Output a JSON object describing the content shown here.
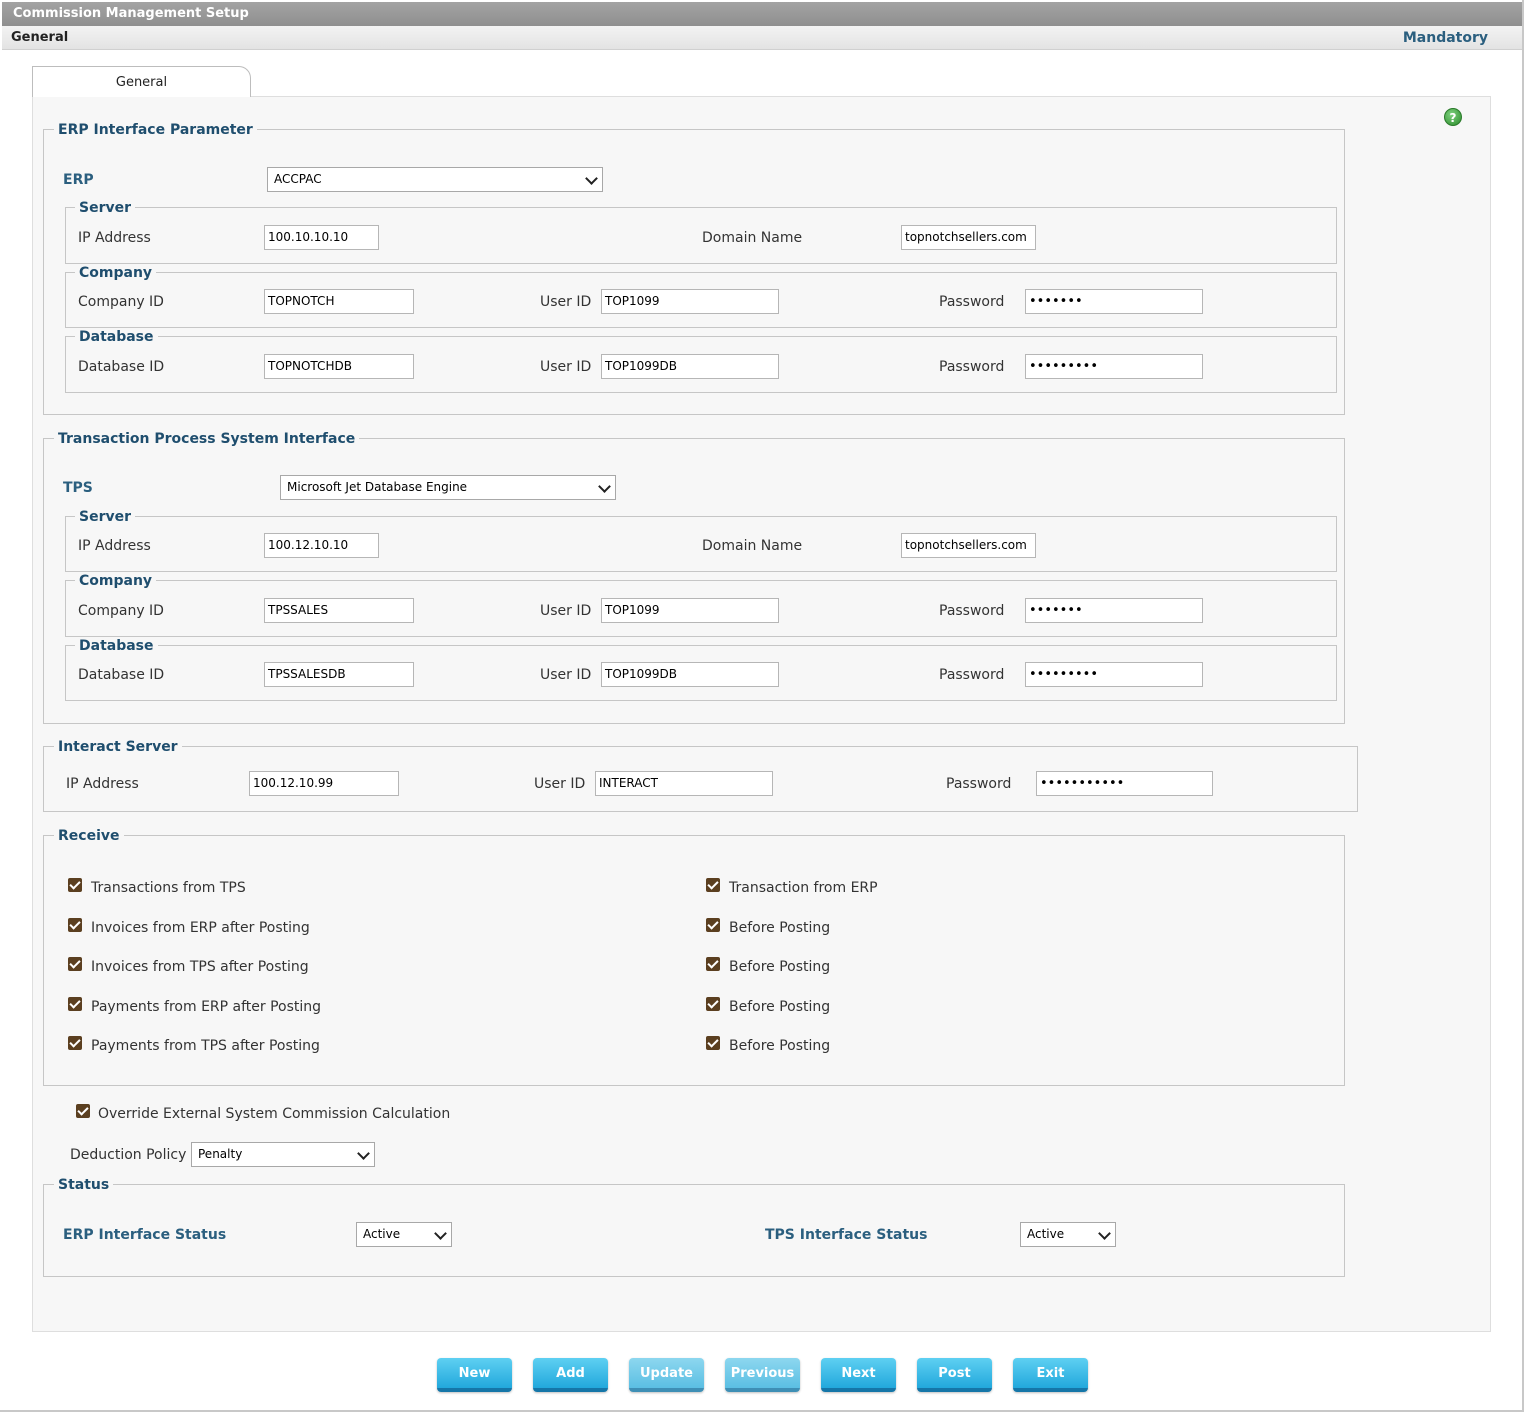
{
  "window": {
    "title": "Commission Management Setup",
    "section": "General",
    "mandatory": "Mandatory"
  },
  "tab": {
    "label": "General"
  },
  "help_icon": "?",
  "erp": {
    "legend": "ERP Interface Parameter",
    "label": "ERP",
    "value": "ACCPAC",
    "server": {
      "legend": "Server",
      "ip_label": "IP Address",
      "ip": "100.10.10.10",
      "domain_label": "Domain Name",
      "domain": "topnotchsellers.com"
    },
    "company": {
      "legend": "Company",
      "id_label": "Company ID",
      "id": "TOPNOTCH",
      "user_label": "User ID",
      "user": "TOP1099",
      "pw_label": "Password",
      "pw": "•••••••"
    },
    "database": {
      "legend": "Database",
      "id_label": "Database ID",
      "id": "TOPNOTCHDB",
      "user_label": "User ID",
      "user": "TOP1099DB",
      "pw_label": "Password",
      "pw": "•••••••••"
    }
  },
  "tps": {
    "legend": "Transaction Process System Interface",
    "label": "TPS",
    "value": "Microsoft Jet Database Engine",
    "server": {
      "legend": "Server",
      "ip_label": "IP Address",
      "ip": "100.12.10.10",
      "domain_label": "Domain Name",
      "domain": "topnotchsellers.com"
    },
    "company": {
      "legend": "Company",
      "id_label": "Company ID",
      "id": "TPSSALES",
      "user_label": "User ID",
      "user": "TOP1099",
      "pw_label": "Password",
      "pw": "•••••••"
    },
    "database": {
      "legend": "Database",
      "id_label": "Database ID",
      "id": "TPSSALESDB",
      "user_label": "User ID",
      "user": "TOP1099DB",
      "pw_label": "Password",
      "pw": "•••••••••"
    }
  },
  "interact": {
    "legend": "Interact Server",
    "ip_label": "IP Address",
    "ip": "100.12.10.99",
    "user_label": "User ID",
    "user": "INTERACT",
    "pw_label": "Password",
    "pw": "•••••••••••"
  },
  "receive": {
    "legend": "Receive",
    "left": [
      "Transactions from TPS",
      "Invoices from ERP after Posting",
      "Invoices from TPS after Posting",
      "Payments from ERP after Posting",
      "Payments from TPS after Posting"
    ],
    "right": [
      "Transaction from ERP",
      "Before Posting",
      "Before Posting",
      "Before Posting",
      "Before Posting"
    ]
  },
  "override": {
    "label": "Override External System Commission Calculation"
  },
  "deduction": {
    "label": "Deduction Policy",
    "value": "Penalty"
  },
  "status": {
    "legend": "Status",
    "erp_label": "ERP Interface Status",
    "erp_value": "Active",
    "tps_label": "TPS Interface Status",
    "tps_value": "Active"
  },
  "buttons": {
    "new": "New",
    "add": "Add",
    "update": "Update",
    "previous": "Previous",
    "next": "Next",
    "post": "Post",
    "exit": "Exit"
  },
  "colors": {
    "title_bar": "#999999",
    "legend_text": "#1f4e6e",
    "checkbox": "#5b3f20",
    "button": "#22a8dc"
  }
}
